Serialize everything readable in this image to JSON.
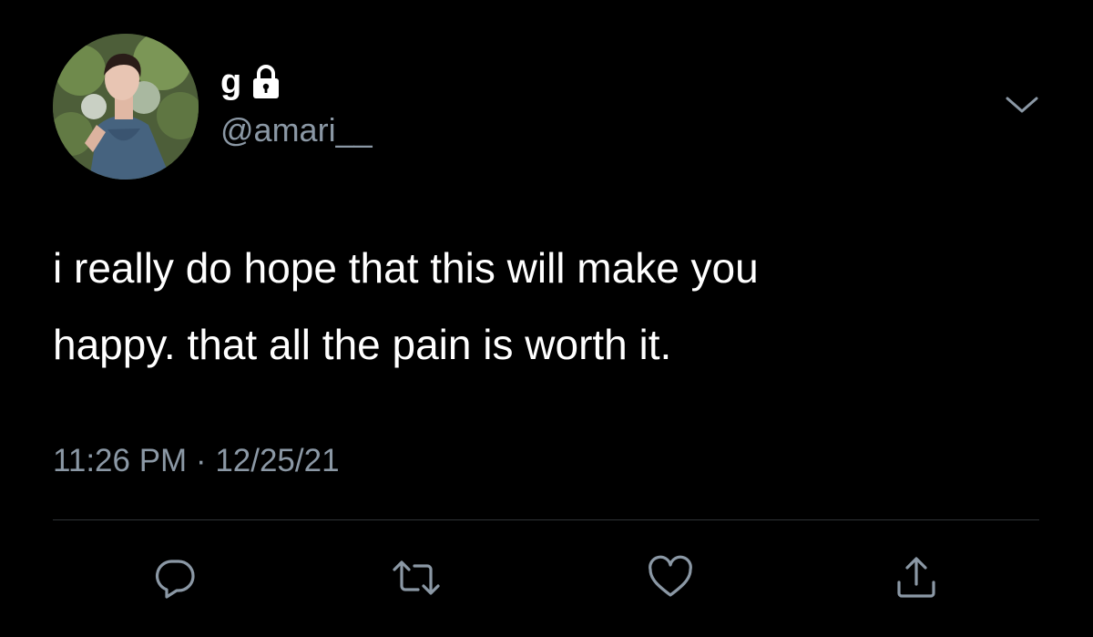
{
  "author": {
    "display_name": "g",
    "handle": "@amari__",
    "protected_icon": "lock-icon",
    "avatar_icon": "profile-photo"
  },
  "tweet": {
    "text_line1": "i really do hope that this will make you",
    "text_line2": "happy. that all the pain is worth it.",
    "timestamp": "11:26 PM · 12/25/21"
  },
  "menu": {
    "icon": "chevron-down-icon"
  },
  "actions": [
    {
      "name": "reply",
      "icon": "reply-icon"
    },
    {
      "name": "retweet",
      "icon": "retweet-icon"
    },
    {
      "name": "like",
      "icon": "heart-icon"
    },
    {
      "name": "share",
      "icon": "share-icon"
    }
  ],
  "colors": {
    "background": "#000000",
    "primary_text": "#ffffff",
    "secondary_text": "#8b98a5",
    "icon": "#8b98a5",
    "divider": "#2f3336"
  }
}
